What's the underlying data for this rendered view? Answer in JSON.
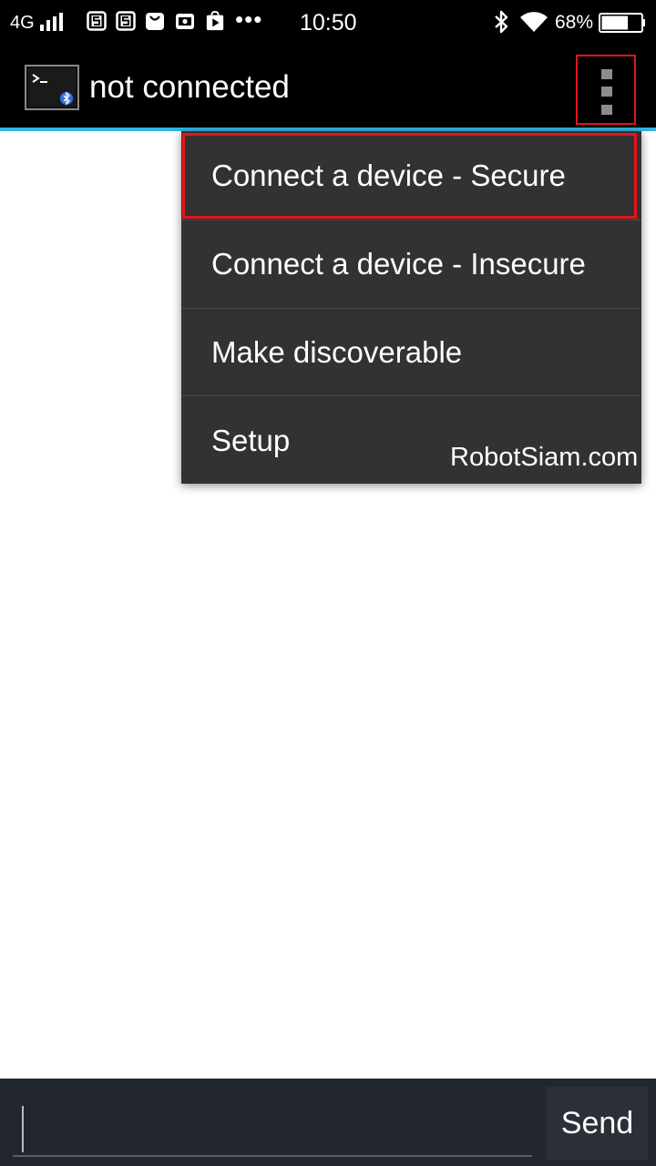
{
  "status_bar": {
    "network": "4G",
    "time": "10:50",
    "battery_percent_text": "68%",
    "battery_level": 0.68,
    "notification_icons": [
      "s-app-icon",
      "s-app-icon",
      "bag-icon",
      "camera-box-icon",
      "play-store-icon"
    ],
    "more_indicator": "•••"
  },
  "app_bar": {
    "title": "not connected",
    "icon": "bluetooth-terminal-icon",
    "overflow_icon": "more-vert-icon"
  },
  "menu": {
    "items": [
      {
        "label": "Connect a device - Secure"
      },
      {
        "label": "Connect a device - Insecure"
      },
      {
        "label": "Make discoverable"
      },
      {
        "label": "Setup"
      }
    ]
  },
  "watermark": "RobotSiam.com",
  "composer": {
    "input_value": "",
    "send_label": "Send"
  },
  "colors": {
    "accent": "#33b5e5",
    "highlight": "#e3151b",
    "menu_bg": "#323232",
    "bar_bg": "#000000"
  }
}
